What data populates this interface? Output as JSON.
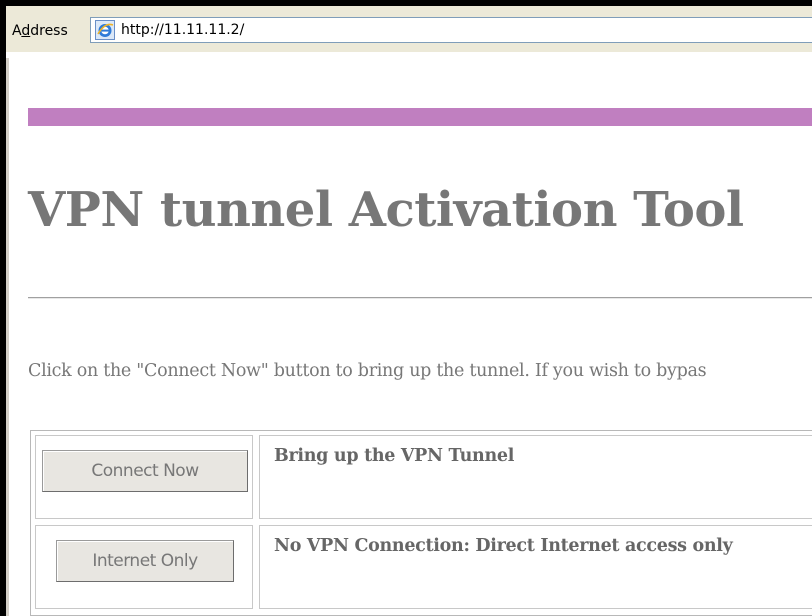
{
  "address_bar": {
    "label_prefix": "A",
    "label_underlined": "d",
    "label_suffix": "dress",
    "url": "http://11.11.11.2/",
    "icon": "internet-explorer-icon"
  },
  "page": {
    "accent_color": "#c07fc0",
    "title": "VPN tunnel Activation Tool",
    "instructions": "Click on the \"Connect Now\" button to bring up the tunnel. If you wish to bypas"
  },
  "options": [
    {
      "button_label": "Connect Now",
      "description": "Bring up the VPN Tunnel"
    },
    {
      "button_label": "Internet Only",
      "description": "No VPN Connection: Direct Internet access only"
    }
  ]
}
